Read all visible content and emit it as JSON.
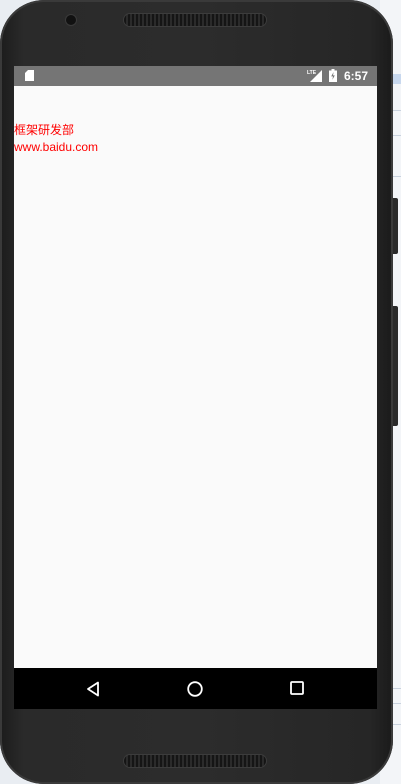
{
  "status_bar": {
    "time": "6:57",
    "network_label": "LTE"
  },
  "app": {
    "lines": [
      "框架研发部",
      "www.baidu.com"
    ],
    "text_color": "#ff0000"
  },
  "navigation": {
    "back": "back-icon",
    "home": "home-icon",
    "recents": "recents-icon"
  }
}
